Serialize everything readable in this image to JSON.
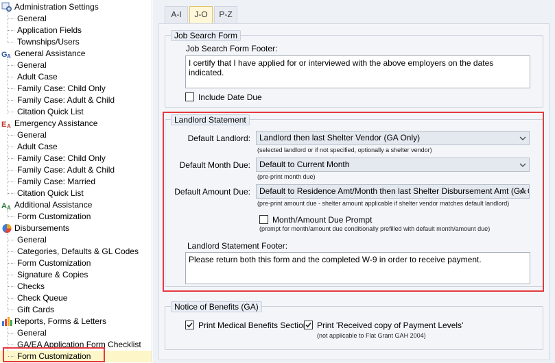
{
  "sidebar": {
    "groups": [
      {
        "label": "Administration Settings",
        "icon": "admin-settings-icon",
        "items": [
          "General",
          "Application Fields",
          "Townships/Users"
        ]
      },
      {
        "label": "General Assistance",
        "icon": "ga-icon",
        "items": [
          "General",
          "Adult Case",
          "Family Case: Child Only",
          "Family Case: Adult & Child",
          "Citation Quick List"
        ]
      },
      {
        "label": "Emergency Assistance",
        "icon": "ea-icon",
        "items": [
          "General",
          "Adult Case",
          "Family Case: Child Only",
          "Family Case: Adult & Child",
          "Family Case: Married",
          "Citation Quick List"
        ]
      },
      {
        "label": "Additional Assistance",
        "icon": "aa-icon",
        "items": [
          "Form Customization"
        ]
      },
      {
        "label": "Disbursements",
        "icon": "pie-chart-icon",
        "items": [
          "General",
          "Categories, Defaults & GL Codes",
          "Form Customization",
          "Signature & Copies",
          "Checks",
          "Check Queue",
          "Gift Cards"
        ]
      },
      {
        "label": "Reports, Forms & Letters",
        "icon": "bar-chart-icon",
        "items": [
          "General",
          "GA/EA Application Form Checklist",
          "Form Customization"
        ]
      }
    ],
    "selected": "Form Customization"
  },
  "tabs": [
    "A-I",
    "J-O",
    "P-Z"
  ],
  "active_tab": "J-O",
  "job_search": {
    "title": "Job Search Form",
    "footer_label": "Job Search Form Footer:",
    "footer_value": "I certify that I have applied for or interviewed with the above employers on the dates indicated.",
    "include_date_due_label": "Include Date Due",
    "include_date_due_checked": false
  },
  "landlord": {
    "title": "Landlord Statement",
    "default_landlord_label": "Default Landlord:",
    "default_landlord_value": "Landlord then last Shelter Vendor (GA Only)",
    "default_landlord_hint": "(selected landlord or if not specified, optionally a shelter vendor)",
    "default_month_label": "Default Month Due:",
    "default_month_value": "Default to Current Month",
    "default_month_hint": "(pre-print month due)",
    "default_amount_label": "Default Amount Due:",
    "default_amount_value": "Default to Residence Amt/Month then last Shelter Disbursement Amt (GA Only)",
    "default_amount_hint": "(pre-print amount due - shelter amount applicable if shelter vendor matches default landlord)",
    "prompt_label": "Month/Amount Due Prompt",
    "prompt_checked": false,
    "prompt_hint": "(prompt for month/amount due conditionally prefilled with default month/amount due)",
    "footer_label": "Landlord Statement Footer:",
    "footer_value": "Please return both this form and the completed W-9 in order to receive payment."
  },
  "benefits": {
    "title": "Notice of Benefits (GA)",
    "medical_label": "Print Medical Benefits Section",
    "medical_checked": true,
    "payment_label": "Print 'Received copy of Payment Levels'",
    "payment_checked": true,
    "payment_hint": "(not applicable to Flat Grant GAH 2004)"
  },
  "colors": {
    "highlight": "#e43a3f",
    "tab_active": "#fff7d8",
    "selected_row": "#fdf6c9"
  }
}
